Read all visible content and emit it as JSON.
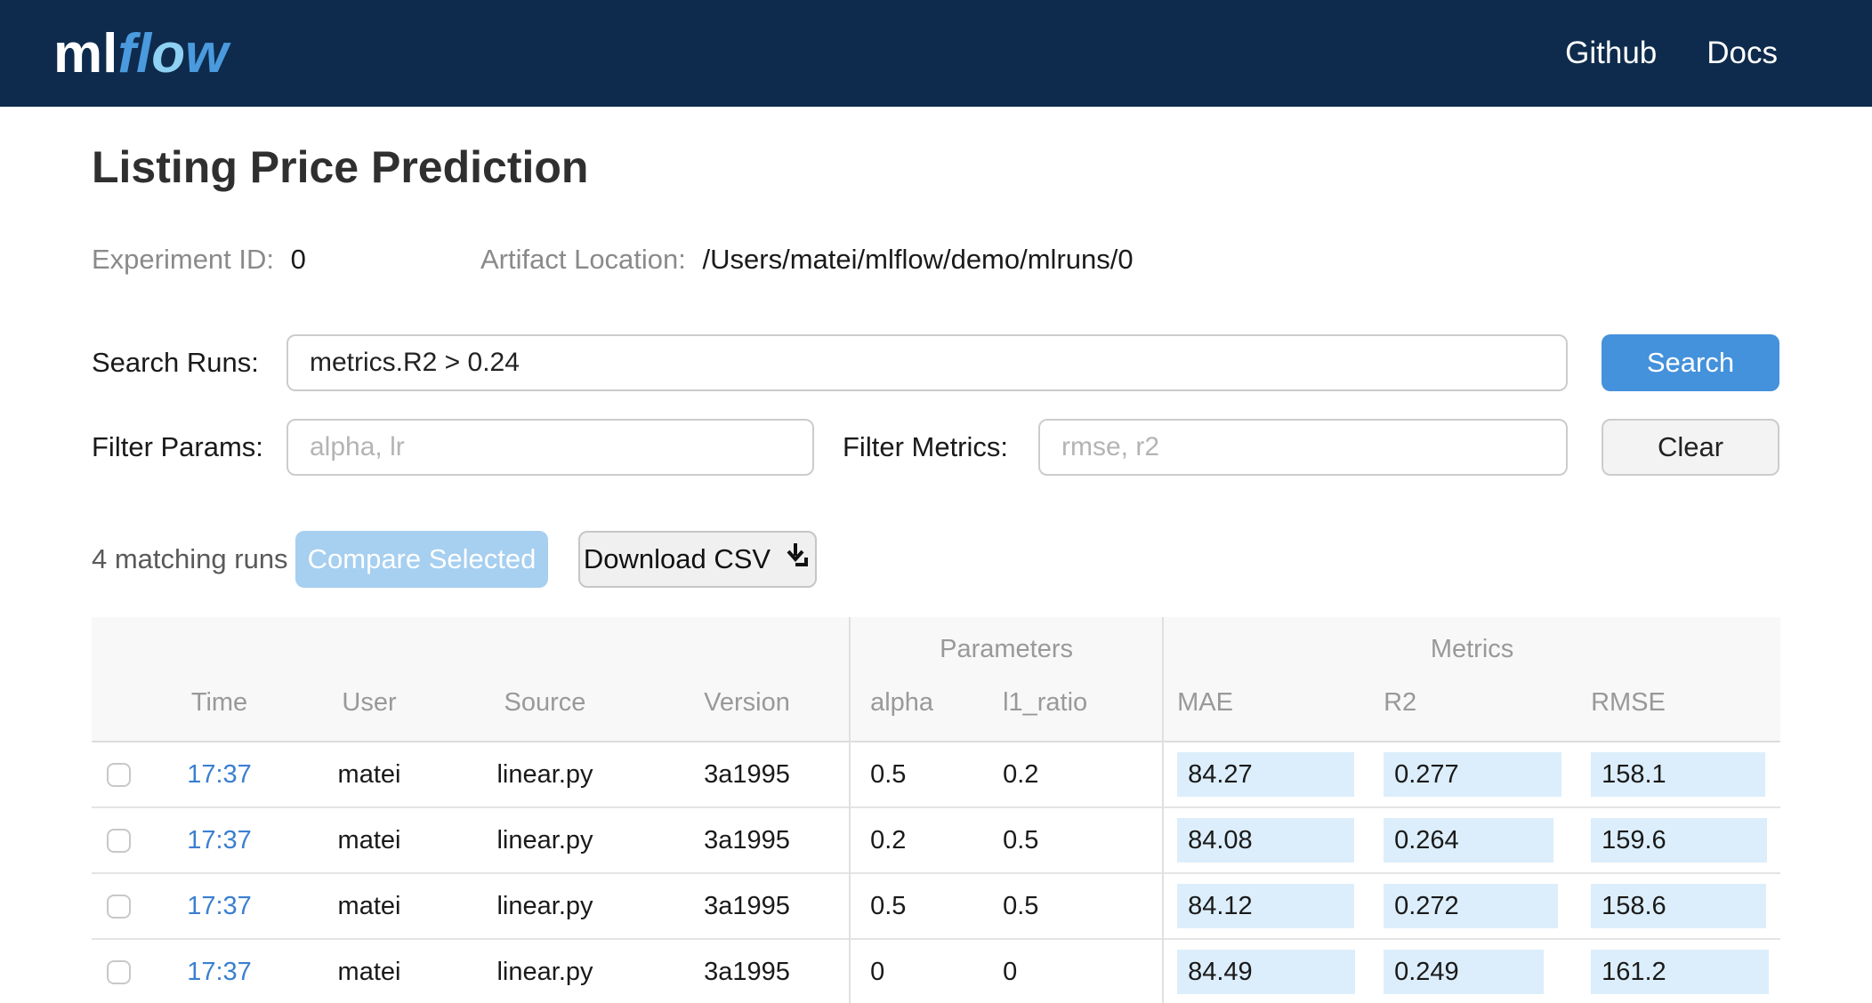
{
  "navbar": {
    "logo_ml": "ml",
    "logo_f": "f",
    "logo_l": "l",
    "logo_o": "o",
    "logo_w": "w",
    "links": [
      {
        "label": "Github"
      },
      {
        "label": "Docs"
      }
    ]
  },
  "header": {
    "title": "Listing Price Prediction",
    "experiment_id_label": "Experiment ID:",
    "experiment_id": "0",
    "artifact_location_label": "Artifact Location:",
    "artifact_location": "/Users/matei/mlflow/demo/mlruns/0"
  },
  "search": {
    "label": "Search Runs:",
    "value": "metrics.R2 > 0.24",
    "button": "Search"
  },
  "filters": {
    "params_label": "Filter Params:",
    "params_placeholder": "alpha, lr",
    "metrics_label": "Filter Metrics:",
    "metrics_placeholder": "rmse, r2",
    "clear_button": "Clear"
  },
  "actions": {
    "matching_runs": "4 matching runs",
    "compare_button": "Compare Selected",
    "download_button": "Download CSV",
    "download_icon": "download-icon"
  },
  "table": {
    "group_headers": {
      "parameters": "Parameters",
      "metrics": "Metrics"
    },
    "columns": {
      "time": "Time",
      "user": "User",
      "source": "Source",
      "version": "Version",
      "alpha": "alpha",
      "l1_ratio": "l1_ratio",
      "mae": "MAE",
      "r2": "R2",
      "rmse": "RMSE"
    },
    "rows": [
      {
        "time": "17:37",
        "user": "matei",
        "source": "linear.py",
        "version": "3a1995",
        "alpha": "0.5",
        "l1_ratio": "0.2",
        "mae": "84.27",
        "r2": "0.277",
        "rmse": "158.1"
      },
      {
        "time": "17:37",
        "user": "matei",
        "source": "linear.py",
        "version": "3a1995",
        "alpha": "0.2",
        "l1_ratio": "0.5",
        "mae": "84.08",
        "r2": "0.264",
        "rmse": "159.6"
      },
      {
        "time": "17:37",
        "user": "matei",
        "source": "linear.py",
        "version": "3a1995",
        "alpha": "0.5",
        "l1_ratio": "0.5",
        "mae": "84.12",
        "r2": "0.272",
        "rmse": "158.6"
      },
      {
        "time": "17:37",
        "user": "matei",
        "source": "linear.py",
        "version": "3a1995",
        "alpha": "0",
        "l1_ratio": "0",
        "mae": "84.49",
        "r2": "0.249",
        "rmse": "161.2"
      }
    ]
  },
  "colors": {
    "navbar_bg": "#0e2b4d",
    "logo_blue": "#4a9add",
    "logo_light_blue": "#8ed1f2",
    "primary_button": "#4491dc",
    "compare_disabled": "#a6cff0",
    "link_blue": "#3b7fd0",
    "metric_highlight": "#dceefb",
    "header_gray_text": "#999999",
    "table_header_bg": "#f8f8f8"
  }
}
